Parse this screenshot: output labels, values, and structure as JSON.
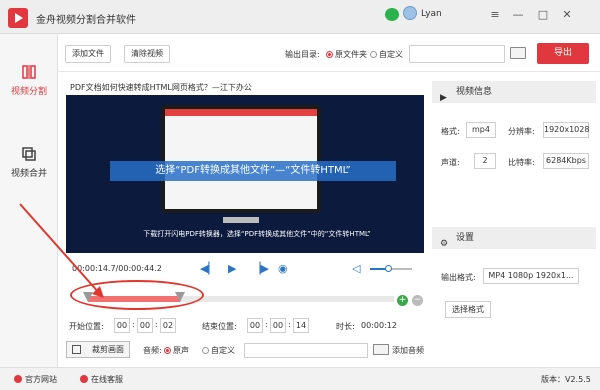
{
  "app": {
    "title": "金舟视频分割合并软件",
    "username": "Lyan"
  },
  "window": {
    "menu": "≡",
    "minimize": "—",
    "maximize": "□",
    "close": "✕"
  },
  "sidebar": {
    "items": [
      {
        "label": "视频分割",
        "active": true
      },
      {
        "label": "视频合并",
        "active": false
      }
    ]
  },
  "toolbar": {
    "add_file": "添加文件",
    "clear_video": "清除视频",
    "output_dir_label": "输出目录:",
    "option_source": "原文件夹",
    "option_custom": "自定义",
    "export": "导出"
  },
  "player": {
    "file_title": "PDF文档如何快速转成HTML网页格式？—江下办公",
    "caption": "选择“PDF转换成其他文件”—“文件转HTML”",
    "sub_caption": "下载打开闪电PDF转换器，选择“PDF转换成其他文件”中的“文件转HTML”",
    "current_time": "00:00:14.7",
    "total_time": "00:00:44.2",
    "volume": 0.45
  },
  "timeline": {
    "selection_start": 0.0,
    "selection_end": 0.3,
    "zoom_in": "+",
    "zoom_out": "−"
  },
  "clip": {
    "start_label": "开始位置:",
    "start": [
      "00",
      "00",
      "02"
    ],
    "end_label": "结束位置:",
    "end": [
      "00",
      "00",
      "14"
    ],
    "duration_label": "时长:",
    "duration": "00:00:12",
    "crop_label": "裁剪画面",
    "audio_label": "音频:",
    "audio_source": "原声",
    "audio_custom": "自定义",
    "add_audio": "添加音频"
  },
  "info": {
    "header": "视频信息",
    "format_label": "格式:",
    "format": "mp4",
    "resolution_label": "分辨率:",
    "resolution": "1920x1028",
    "channels_label": "声道:",
    "channels": "2",
    "bitrate_label": "比特率:",
    "bitrate": "6284Kbps"
  },
  "settings": {
    "header": "设置",
    "output_format_label": "输出格式:",
    "output_format": "MP4 1080p 1920x1...",
    "select_format": "选择格式"
  },
  "footer": {
    "website": "官方网站",
    "support": "在线客服",
    "version": "版本：V2.5.5"
  },
  "colors": {
    "accent": "#e0383e",
    "blue": "#2a76c6",
    "selection": "#f17171"
  }
}
